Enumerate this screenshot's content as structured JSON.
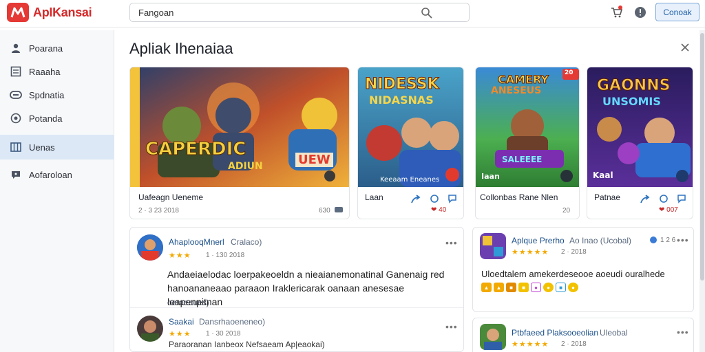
{
  "app": {
    "title": "ApIKansai"
  },
  "search": {
    "value": "Fangoan"
  },
  "header": {
    "button_label": "Conoak",
    "cart_badge_color": "#e53935"
  },
  "sidebar": {
    "items": [
      {
        "label": "Poarana",
        "icon": "person-icon"
      },
      {
        "label": "Raaaha",
        "icon": "list-icon"
      },
      {
        "label": "Spdnatia",
        "icon": "gamepad-icon"
      },
      {
        "label": "Potanda",
        "icon": "clock-icon"
      },
      {
        "label": "Uenas",
        "icon": "grid-icon",
        "active": true
      },
      {
        "label": "Aofaroloan",
        "icon": "chat-icon"
      }
    ]
  },
  "main": {
    "title": "Apliak Ihenaiaa"
  },
  "featured": [
    {
      "art_line1": "CAPERDIC",
      "art_line2": "ADIUN",
      "art_badge": "UEW",
      "title": "Uafeagn Ueneme",
      "meta": "2 · 3 23 2018",
      "meta_right": "630"
    },
    {
      "art_line1": "NIDESSK",
      "art_line2": "NIDASNAS",
      "art_caption": "Keeaam Eneanes",
      "title": "Laan",
      "meta": "❤ 40"
    },
    {
      "art_line1": "CAMERY",
      "art_line2": "ANESEUS",
      "art_line3": "SALEEEE",
      "art_badge": "20",
      "art_caption": "Iaan",
      "title": "Collonbas Rane Nlen",
      "meta": "20"
    },
    {
      "art_line1": "GAONNS",
      "art_line2": "UNSOMIS",
      "art_caption": "Kaal",
      "title": "Patnae",
      "meta": "❤ 007"
    }
  ],
  "reviews_left": [
    {
      "name": "AhaplooqMnerl",
      "tag": "Cralaco)",
      "stars": "★★★",
      "date": "1 · 130 2018",
      "text": "Andaeiaelodac loerpakeoeldn a nieaianemonatinal Ganenaig red hanoananeaao paraaon Iraklericarak oanaan anesesae loapenpitnan",
      "text_extra": "oeraeaues)"
    },
    {
      "name": "Saakai",
      "tag": "Dansrhaoeneneo)",
      "stars": "★★★",
      "date": "1 · 30 2018",
      "text": "Paraoranan Ianbeox Nefsaeam Ap|eaokai)"
    }
  ],
  "reviews_right": [
    {
      "name": "Aplque Prerho",
      "tag": "Ao Inao (Ucobal)",
      "stars": "★★★★★",
      "date": "2 · 2018",
      "side": "1 2 6",
      "text": "Uloedtalem amekerdeseooe aoeudi ouralhede"
    },
    {
      "name": "Ptbfaeed Plaksooeolian",
      "tag": "Uleobal",
      "stars": "★★★★★",
      "date": "2 · 2018",
      "text": ""
    }
  ],
  "colors": {
    "accent": "#1f5fa8",
    "brand": "#d62828",
    "active_nav": "#dce8f6"
  }
}
